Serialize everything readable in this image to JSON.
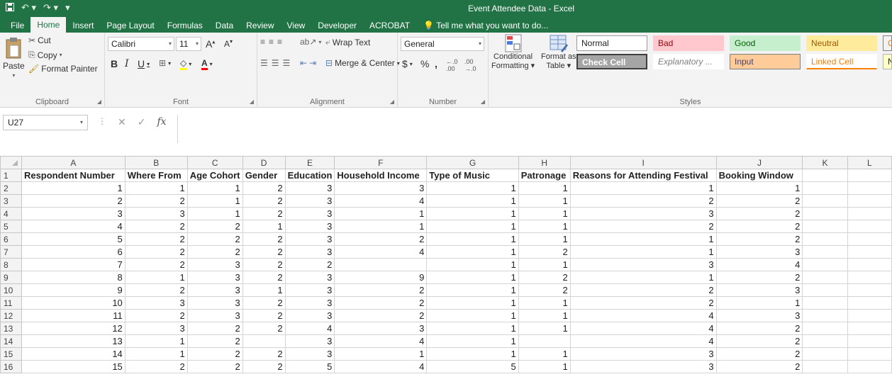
{
  "window": {
    "title": "Event Attendee Data - Excel"
  },
  "qat": {
    "save_icon": "save-icon",
    "undo_icon": "undo-icon",
    "redo_icon": "redo-icon"
  },
  "tabs": [
    "File",
    "Home",
    "Insert",
    "Page Layout",
    "Formulas",
    "Data",
    "Review",
    "View",
    "Developer",
    "ACROBAT"
  ],
  "active_tab": "Home",
  "tellme": "Tell me what you want to do...",
  "clipboard": {
    "paste": "Paste",
    "cut": "Cut",
    "copy": "Copy",
    "format_painter": "Format Painter",
    "label": "Clipboard"
  },
  "font": {
    "name": "Calibri",
    "size": "11",
    "label": "Font"
  },
  "alignment": {
    "wrap": "Wrap Text",
    "merge": "Merge & Center",
    "label": "Alignment"
  },
  "number": {
    "format": "General",
    "label": "Number"
  },
  "styles_group": {
    "conditional": "Conditional",
    "conditional2": "Formatting",
    "format_as": "Format as",
    "format_as2": "Table",
    "label": "Styles",
    "cells": [
      {
        "label": "Normal",
        "bg": "#ffffff",
        "fg": "#222222",
        "border": "#9b9b9b"
      },
      {
        "label": "Bad",
        "bg": "#ffc7ce",
        "fg": "#9c0006",
        "border": "#ffc7ce"
      },
      {
        "label": "Good",
        "bg": "#c6efce",
        "fg": "#006100",
        "border": "#c6efce"
      },
      {
        "label": "Neutral",
        "bg": "#ffeb9c",
        "fg": "#9c5700",
        "border": "#ffeb9c"
      },
      {
        "label": "Ca",
        "bg": "#f2f2f2",
        "fg": "#fa7d00",
        "border": "#7f7f7f"
      },
      {
        "label": "Check Cell",
        "bg": "#a5a5a5",
        "fg": "#ffffff",
        "border": "#3f3f3f"
      },
      {
        "label": "Explanatory ...",
        "bg": "#ffffff",
        "fg": "#7f7f7f",
        "border": "#ffffff"
      },
      {
        "label": "Input",
        "bg": "#ffcc99",
        "fg": "#3f3f76",
        "border": "#7f7f7f"
      },
      {
        "label": "Linked Cell",
        "bg": "#ffffff",
        "fg": "#fa7d00",
        "border": "#ffffff"
      },
      {
        "label": "No",
        "bg": "#ffffcc",
        "fg": "#222222",
        "border": "#b2b2b2"
      }
    ]
  },
  "formula_bar": {
    "cell_ref": "U27",
    "fx": "fx",
    "content": ""
  },
  "columns": [
    "A",
    "B",
    "C",
    "D",
    "E",
    "F",
    "G",
    "H",
    "I",
    "J",
    "K",
    "L"
  ],
  "header_row": [
    "Respondent Number",
    "Where From",
    "Age Cohort",
    "Gender",
    "Education",
    "Household Income",
    "Type of Music",
    "Patronage",
    "Reasons for Attending Festival",
    "Booking Window",
    "",
    ""
  ],
  "rows": [
    [
      "1",
      "1",
      "1",
      "2",
      "3",
      "3",
      "1",
      "1",
      "1",
      "1"
    ],
    [
      "2",
      "2",
      "1",
      "2",
      "3",
      "4",
      "1",
      "1",
      "2",
      "2"
    ],
    [
      "3",
      "3",
      "1",
      "2",
      "3",
      "1",
      "1",
      "1",
      "3",
      "2"
    ],
    [
      "4",
      "2",
      "2",
      "1",
      "3",
      "1",
      "1",
      "1",
      "2",
      "2"
    ],
    [
      "5",
      "2",
      "2",
      "2",
      "3",
      "2",
      "1",
      "1",
      "1",
      "2"
    ],
    [
      "6",
      "2",
      "2",
      "2",
      "3",
      "4",
      "1",
      "2",
      "1",
      "3"
    ],
    [
      "7",
      "2",
      "3",
      "2",
      "2",
      "",
      "1",
      "1",
      "3",
      "4"
    ],
    [
      "8",
      "1",
      "3",
      "2",
      "3",
      "9",
      "1",
      "2",
      "1",
      "2"
    ],
    [
      "9",
      "2",
      "3",
      "1",
      "3",
      "2",
      "1",
      "2",
      "2",
      "3"
    ],
    [
      "10",
      "3",
      "3",
      "2",
      "3",
      "2",
      "1",
      "1",
      "2",
      "1"
    ],
    [
      "11",
      "2",
      "3",
      "2",
      "3",
      "2",
      "1",
      "1",
      "4",
      "3"
    ],
    [
      "12",
      "3",
      "2",
      "2",
      "4",
      "3",
      "1",
      "1",
      "4",
      "2"
    ],
    [
      "13",
      "1",
      "2",
      "",
      "3",
      "4",
      "1",
      "",
      "4",
      "2"
    ],
    [
      "14",
      "1",
      "2",
      "2",
      "3",
      "1",
      "1",
      "1",
      "3",
      "2"
    ],
    [
      "15",
      "2",
      "2",
      "2",
      "5",
      "4",
      "5",
      "1",
      "3",
      "2"
    ]
  ]
}
